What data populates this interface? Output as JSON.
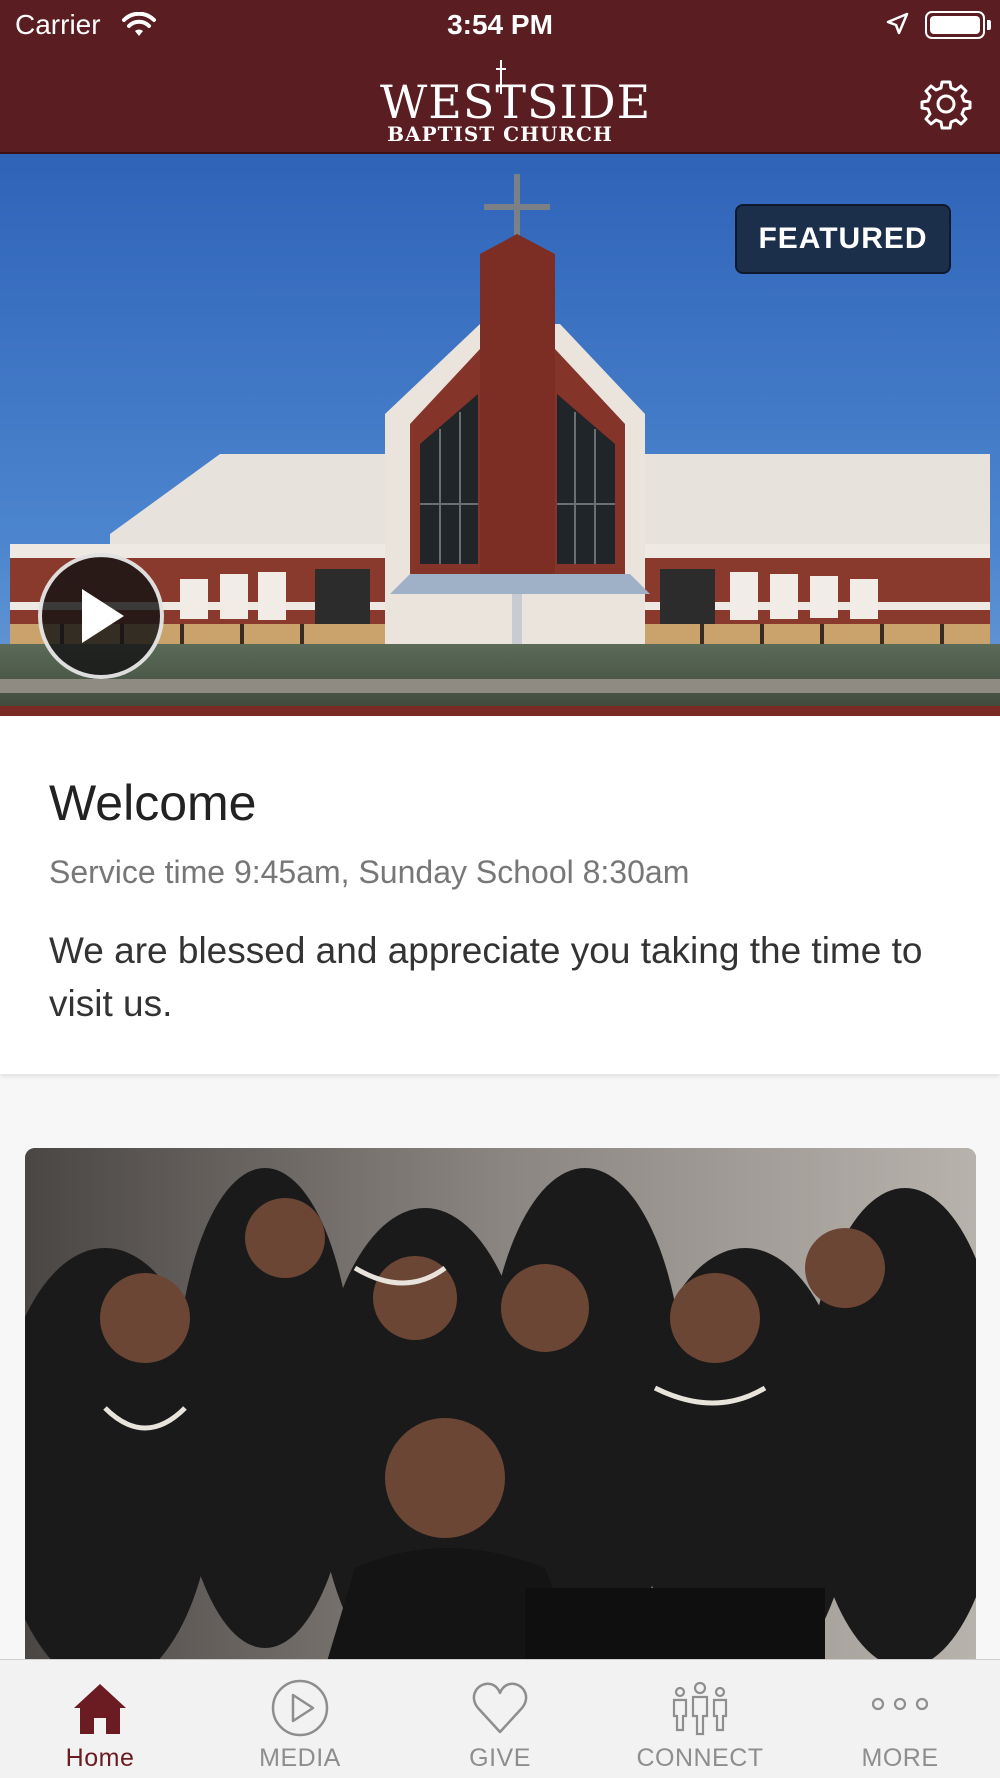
{
  "status_bar": {
    "carrier": "Carrier",
    "time": "3:54 PM"
  },
  "header": {
    "logo_line1": "WESTSIDE",
    "logo_line2": "BAPTIST CHURCH",
    "settings_icon": "gear-icon"
  },
  "featured": {
    "badge": "FEATURED",
    "play_icon": "play-icon"
  },
  "welcome": {
    "title": "Welcome",
    "subtitle": "Service time 9:45am, Sunday School 8:30am",
    "body": "We are blessed and appreciate you taking the time to visit us."
  },
  "tabs": [
    {
      "label": "Home",
      "icon": "home-icon",
      "active": true
    },
    {
      "label": "MEDIA",
      "icon": "play-circle-icon",
      "active": false
    },
    {
      "label": "GIVE",
      "icon": "heart-icon",
      "active": false
    },
    {
      "label": "CONNECT",
      "icon": "people-icon",
      "active": false
    },
    {
      "label": "MORE",
      "icon": "more-dots-icon",
      "active": false
    }
  ],
  "colors": {
    "header_bg": "#5a1d22",
    "badge_bg": "#1c2f4a",
    "active_tab": "#6b1c22",
    "inactive_tab": "#8e8e8e"
  }
}
